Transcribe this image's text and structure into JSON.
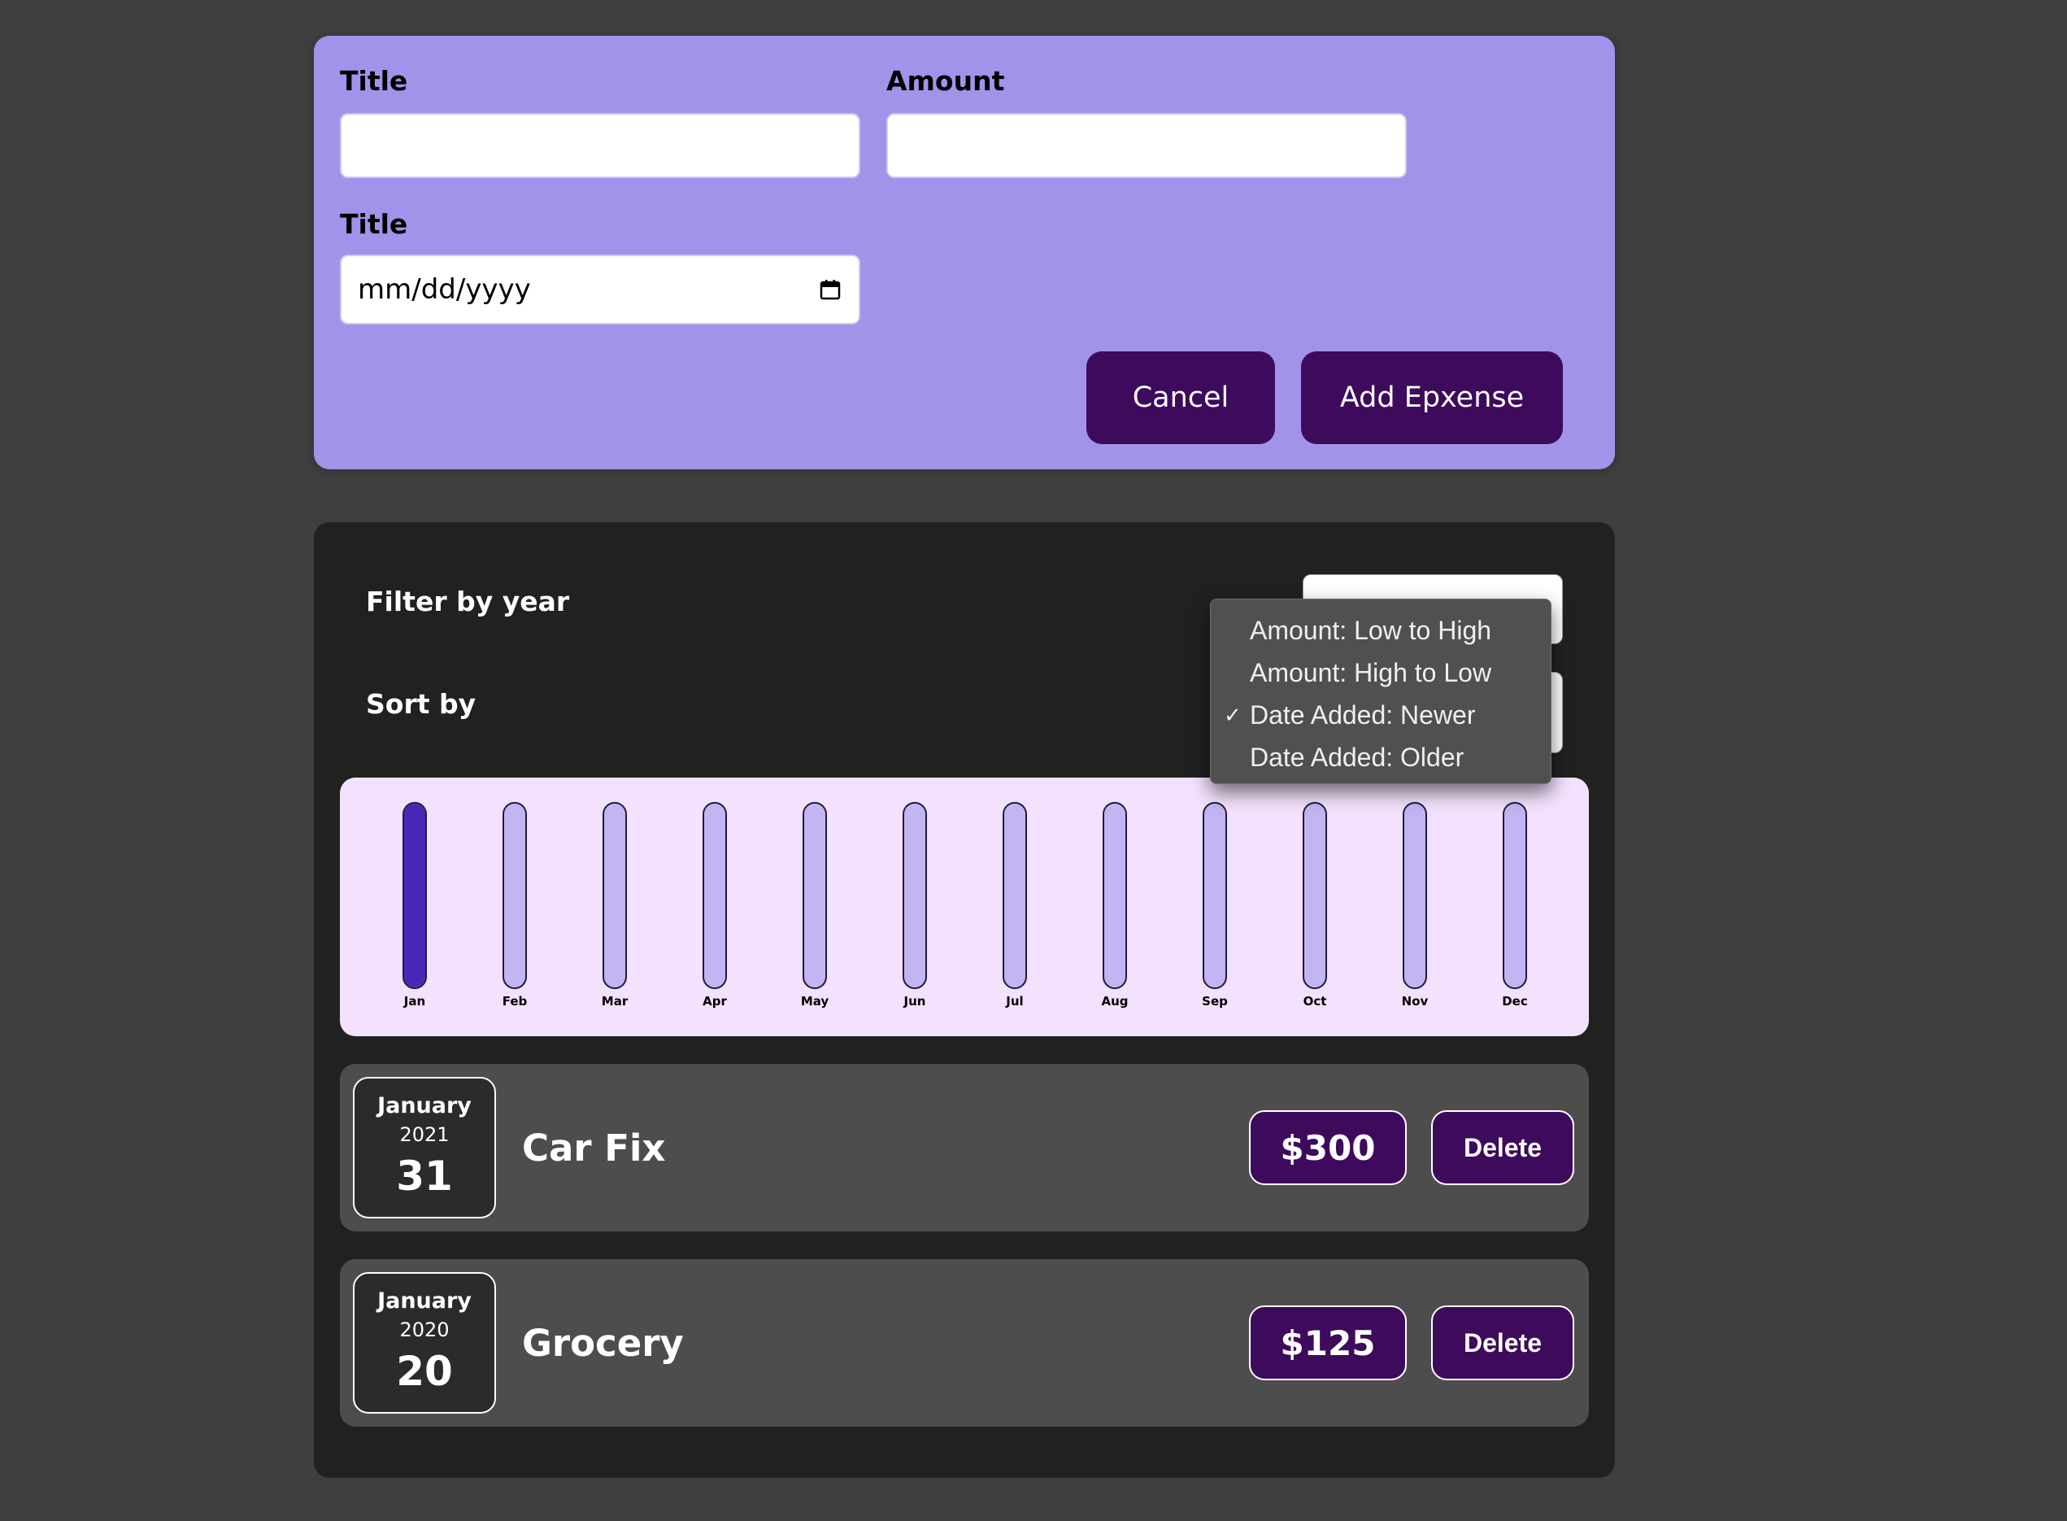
{
  "form": {
    "title_label": "Title",
    "title_value": "",
    "amount_label": "Amount",
    "amount_value": "",
    "date_label": "Title",
    "date_placeholder": "mm/dd/yyyy",
    "cancel_label": "Cancel",
    "add_label": "Add Epxense"
  },
  "filters": {
    "year_label": "Filter by year",
    "sort_label": "Sort by",
    "sort_options": [
      "Amount: Low to High",
      "Amount: High to Low",
      "Date Added: Newer",
      "Date Added: Older"
    ],
    "selected_sort": "Date Added: Newer",
    "check_glyph": "✓"
  },
  "chart_data": {
    "type": "bar",
    "categories": [
      "Jan",
      "Feb",
      "Mar",
      "Apr",
      "May",
      "Jun",
      "Jul",
      "Aug",
      "Sep",
      "Oct",
      "Nov",
      "Dec"
    ],
    "values": [
      1,
      0,
      0,
      0,
      0,
      0,
      0,
      0,
      0,
      0,
      0,
      0
    ],
    "ylim": [
      0,
      1
    ],
    "fill_color": "#4a27b8",
    "track_color": "#c2b5f2"
  },
  "expenses": [
    {
      "month": "January",
      "year": "2021",
      "day": "31",
      "title": "Car Fix",
      "amount": "$300",
      "delete_label": "Delete"
    },
    {
      "month": "January",
      "year": "2020",
      "day": "20",
      "title": "Grocery",
      "amount": "$125",
      "delete_label": "Delete"
    }
  ],
  "colors": {
    "form_bg": "#a293ea",
    "button_bg": "#3d0a5c",
    "panel_bg": "#212121",
    "chart_bg": "#f3e1fd",
    "item_bg": "#4d4d4d"
  }
}
